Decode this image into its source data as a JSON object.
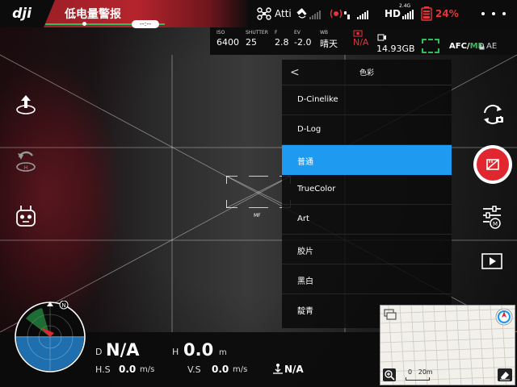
{
  "topbar": {
    "logo": "dji",
    "warning": "低电量警报",
    "warning_pill": "--:--",
    "flight_mode": "Atti",
    "hd_label": "HD",
    "hd_band": "2.4G",
    "battery": "24%"
  },
  "camera_settings": {
    "iso_label": "ISO",
    "iso_value": "6400",
    "shutter_label": "SHUTTER",
    "shutter_value": "25",
    "f_label": "F",
    "f_value": "2.8",
    "ev_label": "EV",
    "ev_value": "-2.0",
    "wb_label": "WB",
    "wb_value": "晴天",
    "na_value": "N/A",
    "sd_value": "14.93GB",
    "afc_label": "AFC/",
    "mf_label": "MF",
    "ae_label": "AE"
  },
  "focus": {
    "mf_label": "MF"
  },
  "color_menu": {
    "back": "<",
    "title": "色彩",
    "items": [
      {
        "label": "D-Cinelike"
      },
      {
        "label": "D-Log"
      },
      {
        "label": "普通",
        "selected": true
      },
      {
        "label": "TrueColor"
      },
      {
        "label": "Art"
      },
      {
        "label": "胶片"
      },
      {
        "label": "黑白"
      },
      {
        "label": "靛青"
      }
    ]
  },
  "dashboard": {
    "d_label": "D",
    "d_value": "N/A",
    "h_label": "H",
    "h_value": "0.0",
    "h_unit": "m",
    "hs_label": "H.S",
    "hs_value": "0.0",
    "hs_unit": "m/s",
    "vs_label": "V.S",
    "vs_value": "0.0",
    "vs_unit": "m/s",
    "vps_value": "N/A"
  },
  "radar": {
    "north": "N"
  },
  "minimap": {
    "scale_zero": "0",
    "scale_label": "20m"
  },
  "colors": {
    "accent": "#1e9af0",
    "warning_red": "#b5242d",
    "battery_red": "#e6343d",
    "status_green": "#2fbf5a",
    "record_red": "#e0262f"
  }
}
